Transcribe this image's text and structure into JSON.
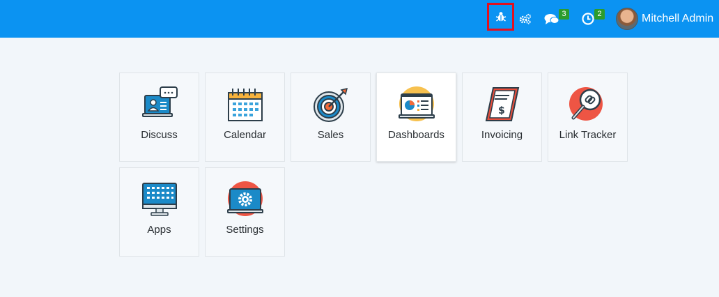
{
  "topbar": {
    "icons": {
      "debug": "bug-icon",
      "settings": "gears-icon",
      "messages": "chat-icon",
      "activities": "clock-icon"
    },
    "messages_badge": "3",
    "activities_badge": "2",
    "user_name": "Mitchell Admin",
    "bar_color": "#0b93f2",
    "highlight_color": "#e3101f"
  },
  "apps": [
    {
      "label": "Discuss",
      "icon": "discuss-icon"
    },
    {
      "label": "Calendar",
      "icon": "calendar-icon"
    },
    {
      "label": "Sales",
      "icon": "target-icon"
    },
    {
      "label": "Dashboards",
      "icon": "dashboard-icon"
    },
    {
      "label": "Invoicing",
      "icon": "invoice-icon"
    },
    {
      "label": "Link Tracker",
      "icon": "link-tracker-icon"
    },
    {
      "label": "Apps",
      "icon": "apps-icon"
    },
    {
      "label": "Settings",
      "icon": "settings-icon"
    }
  ]
}
